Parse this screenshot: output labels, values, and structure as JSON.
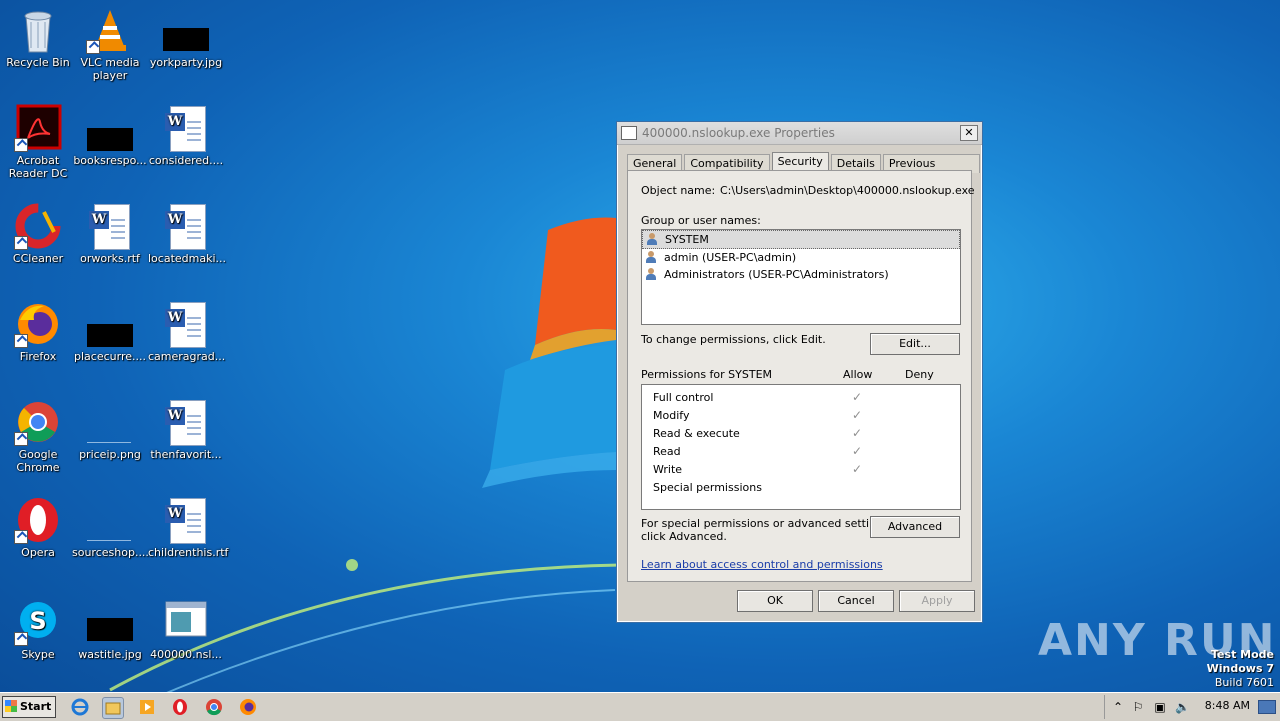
{
  "desktop": {
    "icons": [
      {
        "label": "Recycle Bin",
        "icon": "recycle-bin-icon"
      },
      {
        "label": "VLC media player",
        "icon": "vlc-icon"
      },
      {
        "label": "yorkparty.jpg",
        "icon": "image-file-icon"
      },
      {
        "label": "Acrobat Reader DC",
        "icon": "acrobat-icon"
      },
      {
        "label": "booksrespo...",
        "icon": "image-file-icon"
      },
      {
        "label": "considered....",
        "icon": "word-doc-icon"
      },
      {
        "label": "CCleaner",
        "icon": "ccleaner-icon"
      },
      {
        "label": "orworks.rtf",
        "icon": "word-doc-icon"
      },
      {
        "label": "locatedmaki...",
        "icon": "word-doc-icon"
      },
      {
        "label": "Firefox",
        "icon": "firefox-icon"
      },
      {
        "label": "placecurre....",
        "icon": "image-file-icon"
      },
      {
        "label": "cameragrad...",
        "icon": "word-doc-icon"
      },
      {
        "label": "Google Chrome",
        "icon": "chrome-icon"
      },
      {
        "label": "priceip.png",
        "icon": "image-file-icon"
      },
      {
        "label": "thenfavorit...",
        "icon": "word-doc-icon"
      },
      {
        "label": "Opera",
        "icon": "opera-icon"
      },
      {
        "label": "sourceshop....",
        "icon": "image-file-icon"
      },
      {
        "label": "childrenthis.rtf",
        "icon": "word-doc-icon"
      },
      {
        "label": "Skype",
        "icon": "skype-icon"
      },
      {
        "label": "wastitle.jpg",
        "icon": "image-file-icon"
      },
      {
        "label": "400000.nsl...",
        "icon": "exe-file-icon"
      }
    ]
  },
  "dialog": {
    "title": "400000.nslookup.exe Properties",
    "close_label": "✕",
    "tabs": [
      "General",
      "Compatibility",
      "Security",
      "Details",
      "Previous Versions"
    ],
    "object_name_label": "Object name:",
    "object_name_value": "C:\\Users\\admin\\Desktop\\400000.nslookup.exe",
    "group_label": "Group or user names:",
    "users": [
      "SYSTEM",
      "admin (USER-PC\\admin)",
      "Administrators (USER-PC\\Administrators)"
    ],
    "change_perm_text": "To change permissions, click Edit.",
    "edit_button": "Edit...",
    "permissions_for": "Permissions for SYSTEM",
    "allow_header": "Allow",
    "deny_header": "Deny",
    "permissions": [
      {
        "name": "Full control",
        "allow": true
      },
      {
        "name": "Modify",
        "allow": true
      },
      {
        "name": "Read & execute",
        "allow": true
      },
      {
        "name": "Read",
        "allow": true
      },
      {
        "name": "Write",
        "allow": true
      },
      {
        "name": "Special permissions",
        "allow": false
      }
    ],
    "special_text_1": "For special permissions or advanced settings,",
    "special_text_2": "click Advanced.",
    "advanced_button": "Advanced",
    "learn_link": "Learn about access control and permissions",
    "ok_button": "OK",
    "cancel_button": "Cancel",
    "apply_button": "Apply"
  },
  "watermark": {
    "brand": "ANY RUN",
    "test_mode": "Test Mode",
    "os": "Windows 7",
    "build": "Build 7601"
  },
  "taskbar": {
    "start_label": "Start",
    "clock": "8:48 AM",
    "pinned": [
      "internet-explorer-icon",
      "explorer-icon",
      "media-player-icon",
      "opera-icon",
      "chrome-icon",
      "firefox-icon"
    ]
  },
  "colors": {
    "desktop_blue": "#1a86d4",
    "dialog_bg": "#d4d0c8",
    "link": "#1a3da8"
  }
}
